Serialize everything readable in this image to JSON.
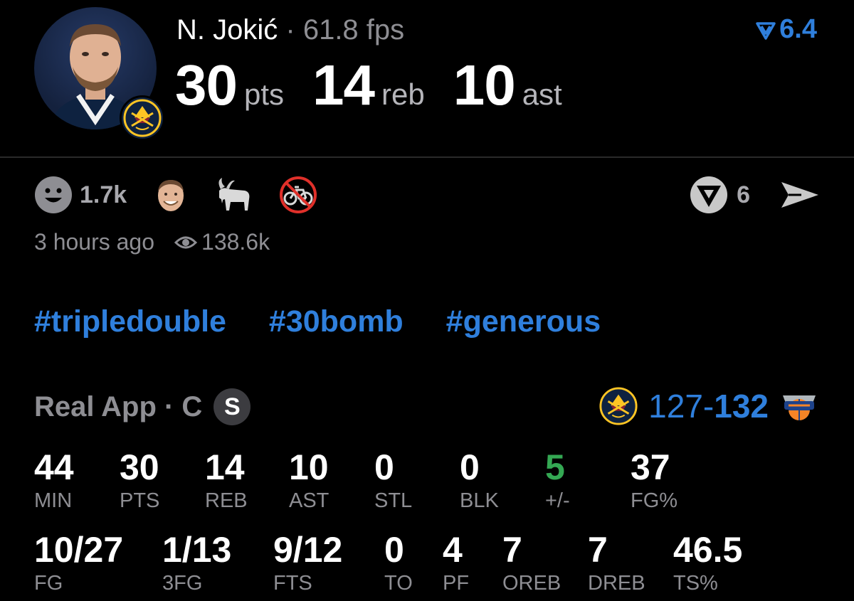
{
  "player": {
    "name": "N. Jokić",
    "separator": "·",
    "fps": "61.8 fps",
    "rating": "6.4"
  },
  "headline": [
    {
      "value": "30",
      "unit": "pts"
    },
    {
      "value": "14",
      "unit": "reb"
    },
    {
      "value": "10",
      "unit": "ast"
    }
  ],
  "reactions": {
    "smile_count": "1.7k",
    "vote_count": "6"
  },
  "meta": {
    "time_ago": "3 hours ago",
    "views": "138.6k"
  },
  "tags": [
    "#tripledouble",
    "#30bomb",
    "#generous"
  ],
  "game": {
    "source": "Real App · C",
    "badge": "S",
    "score_home": "127",
    "score_dash": "-",
    "score_away": "132"
  },
  "stats_row1": [
    {
      "value": "44",
      "label": "MIN"
    },
    {
      "value": "30",
      "label": "PTS"
    },
    {
      "value": "14",
      "label": "REB"
    },
    {
      "value": "10",
      "label": "AST"
    },
    {
      "value": "0",
      "label": "STL"
    },
    {
      "value": "0",
      "label": "BLK"
    },
    {
      "value": "5",
      "label": "+/-"
    },
    {
      "value": "37",
      "label": "FG%"
    }
  ],
  "stats_row2": [
    {
      "value": "10/27",
      "label": "FG"
    },
    {
      "value": "1/13",
      "label": "3FG"
    },
    {
      "value": "9/12",
      "label": "FTS"
    },
    {
      "value": "0",
      "label": "TO"
    },
    {
      "value": "4",
      "label": "PF"
    },
    {
      "value": "7",
      "label": "OREB"
    },
    {
      "value": "7",
      "label": "DREB"
    },
    {
      "value": "46.5",
      "label": "TS%"
    }
  ],
  "colors": {
    "accent": "#2f7fdc",
    "positive": "#34a853",
    "muted": "#8e8e93",
    "background": "#000000"
  }
}
